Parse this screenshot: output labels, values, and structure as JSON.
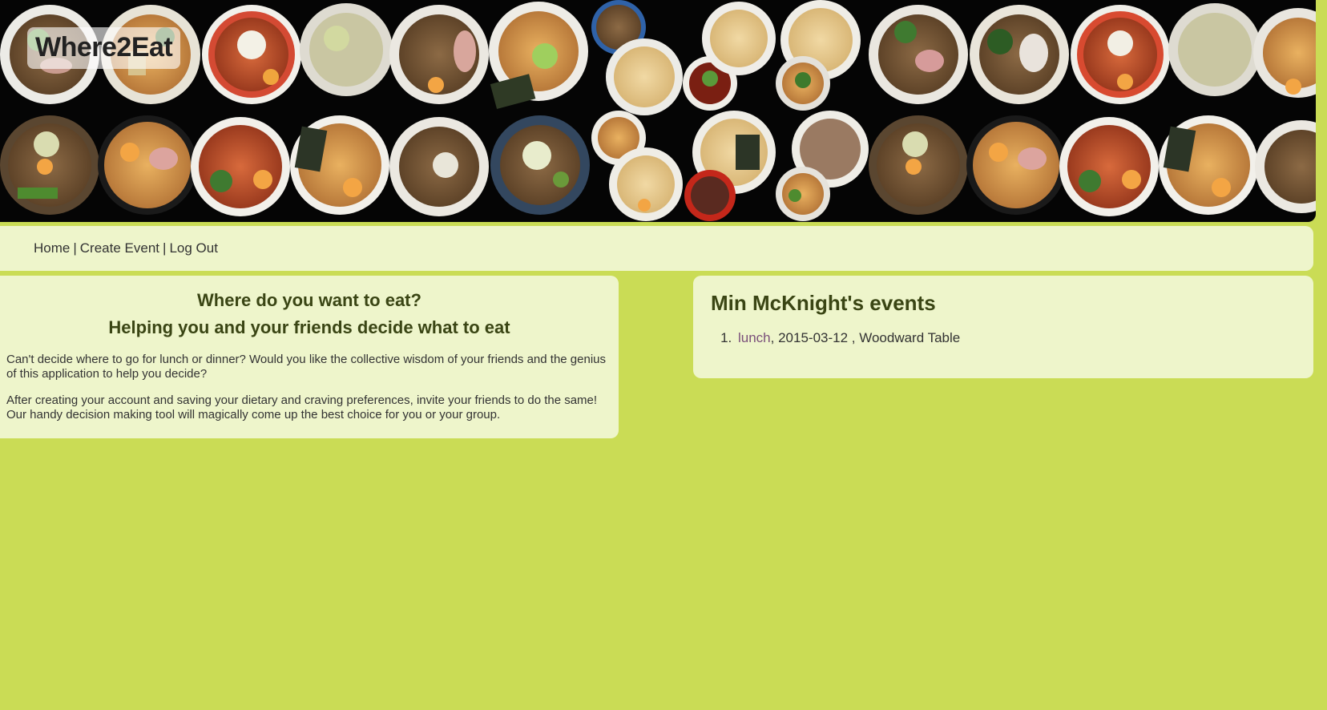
{
  "app": {
    "logo": "Where2Eat"
  },
  "nav": {
    "home": "Home",
    "create_event": "Create Event",
    "log_out": "Log Out",
    "separator": "|"
  },
  "intro": {
    "heading": "Where do you want to eat?",
    "subheading": "Helping you and your friends decide what to eat",
    "paragraph1": "Can't decide where to go for lunch or dinner? Would you like the collective wisdom of your friends and the genius of this application to help you decide?",
    "paragraph2": "After creating your account and saving your dietary and craving preferences, invite your friends to do the same! Our handy decision making tool will magically come up the best choice for you or your group."
  },
  "events": {
    "heading": "Min McKnight's events",
    "items": [
      {
        "name": "lunch",
        "details": ", 2015-03-12 , Woodward Table"
      }
    ]
  },
  "colors": {
    "page_bg": "#cadc55",
    "panel_bg": "#eef5cb",
    "heading": "#3a4514",
    "link_visited": "#7a4f7a",
    "banner_bg": "#050505"
  }
}
